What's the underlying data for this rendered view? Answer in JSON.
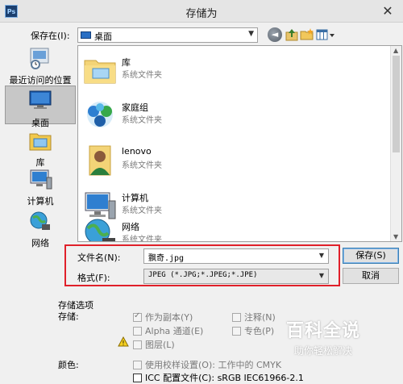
{
  "window": {
    "title": "存储为",
    "app_icon_text": "Ps",
    "close_glyph": "✕"
  },
  "location": {
    "label": "保存在(I):",
    "value": "桌面",
    "arrow": "▼"
  },
  "toolbar": {
    "back_glyph": "◄",
    "icons": [
      "back-icon",
      "up-folder-icon",
      "new-folder-icon",
      "view-menu-icon"
    ]
  },
  "places": [
    {
      "label": "最近访问的位置",
      "icon": "recent-places-icon"
    },
    {
      "label": "桌面",
      "icon": "desktop-icon",
      "selected": true
    },
    {
      "label": "库",
      "icon": "libraries-icon"
    },
    {
      "label": "计算机",
      "icon": "computer-icon"
    },
    {
      "label": "网络",
      "icon": "network-icon"
    }
  ],
  "files": [
    {
      "name": "库",
      "type": "系统文件夹",
      "icon": "library-folder-icon"
    },
    {
      "name": "家庭组",
      "type": "系统文件夹",
      "icon": "homegroup-icon"
    },
    {
      "name": "lenovo",
      "type": "系统文件夹",
      "icon": "user-folder-icon"
    },
    {
      "name": "计算机",
      "type": "系统文件夹",
      "icon": "computer-icon"
    },
    {
      "name": "网络",
      "type": "系统文件夹",
      "icon": "network-icon"
    }
  ],
  "scrollbar": {
    "up": "▲",
    "down": "▼"
  },
  "form": {
    "filename_label": "文件名(N):",
    "filename_value": "飘奇.jpg",
    "format_label": "格式(F):",
    "format_value": "JPEG (*.JPG;*.JPEG;*.JPE)",
    "dropdown_arrow": "▼"
  },
  "buttons": {
    "save": "保存(S)",
    "cancel": "取消"
  },
  "options": {
    "section_title": "存储选项",
    "save_label": "存储:",
    "as_copy": "作为副本(Y)",
    "alpha": "Alpha 通道(E)",
    "layers": "图层(L)",
    "notes": "注释(N)",
    "spot": "专色(P)",
    "warning_glyph": "!",
    "color_label": "颜色:",
    "proof": "使用校样设置(O): 工作中的 CMYK",
    "icc": "ICC 配置文件(C): sRGB IEC61966-2.1"
  },
  "watermark": {
    "title": "百科全说",
    "subtitle": "助你轻松解决"
  },
  "colors": {
    "highlight": "#e0202a",
    "desktop_blue": "#2a6fc4"
  }
}
